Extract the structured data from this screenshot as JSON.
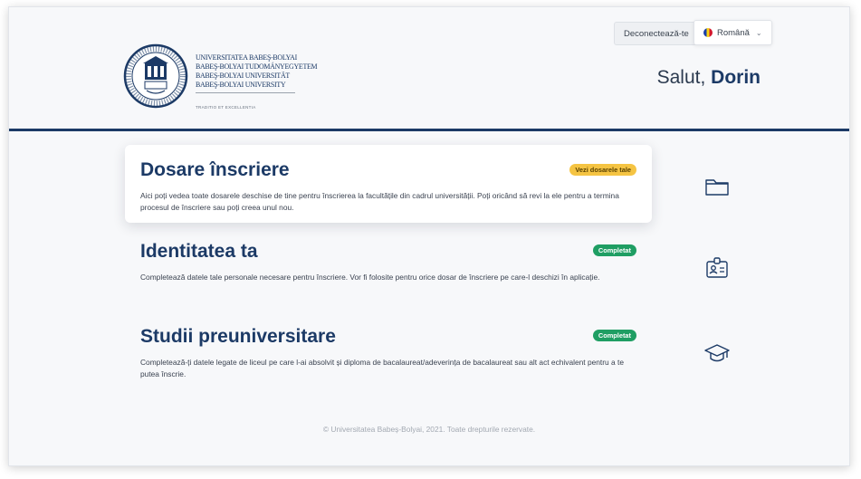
{
  "header": {
    "university_lines": [
      "UNIVERSITATEA BABEŞ-BOLYAI",
      "BABEŞ-BOLYAI TUDOMÁNYEGYETEM",
      "BABEŞ-BOLYAI UNIVERSITÄT",
      "BABEŞ-BOLYAI UNIVERSITY"
    ],
    "motto": "TRADITIO ET EXCELLENTIA",
    "logout_label": "Deconectează-te",
    "language_label": "Română",
    "greeting_prefix": "Salut,",
    "user_name": "Dorin"
  },
  "sections": [
    {
      "title": "Dosare înscriere",
      "badge": "Vezi dosarele tale",
      "badge_color": "#f5c443",
      "description": "Aici poți vedea toate dosarele deschise de tine pentru înscrierea la facultățile din cadrul universității. Poți oricând să revi la ele pentru a termina procesul de înscriere sau poți creea unul nou.",
      "icon": "folder-icon"
    },
    {
      "title": "Identitatea ta",
      "badge": "Completat",
      "badge_color": "#1f9e63",
      "description": "Completează datele tale personale necesare pentru înscriere. Vor fi folosite pentru orice dosar de înscriere pe care-l deschizi în aplicație.",
      "icon": "id-badge-icon"
    },
    {
      "title": "Studii preuniversitare",
      "badge": "Completat",
      "badge_color": "#1f9e63",
      "description": "Completează-ți datele legate de liceul pe care l-ai absolvit și diploma de bacalaureat/adeverința de bacalaureat sau alt act echivalent pentru a te putea înscrie.",
      "icon": "graduation-cap-icon"
    }
  ],
  "footer": {
    "copyright": "© Universitatea Babeș-Bolyai, 2021. Toate drepturile rezervate."
  },
  "colors": {
    "primary": "#1c3a66",
    "page_background": "#f7f8fa"
  }
}
